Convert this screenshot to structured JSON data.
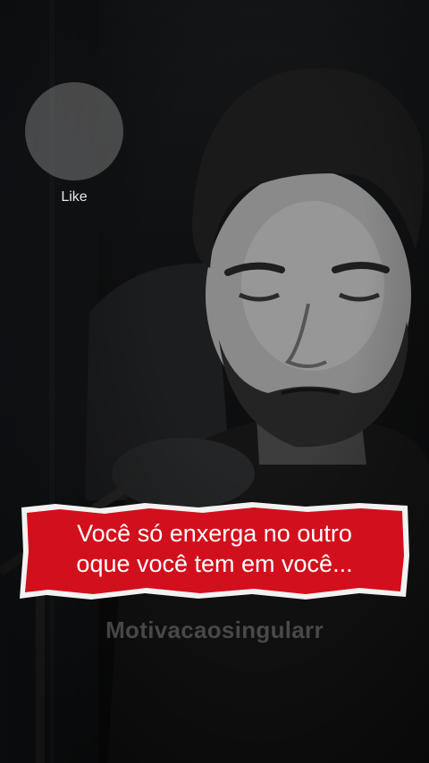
{
  "like": {
    "label": "Like"
  },
  "caption": {
    "line1": "Você só enxerga no outro",
    "line2": "oque você tem em você..."
  },
  "watermark": {
    "text": "Motivacaosingularr"
  },
  "colors": {
    "banner_red": "#d20f1c",
    "banner_edge": "#f2f2f2",
    "caption_text": "#ffffff",
    "like_circle": "#7a7a7a"
  }
}
